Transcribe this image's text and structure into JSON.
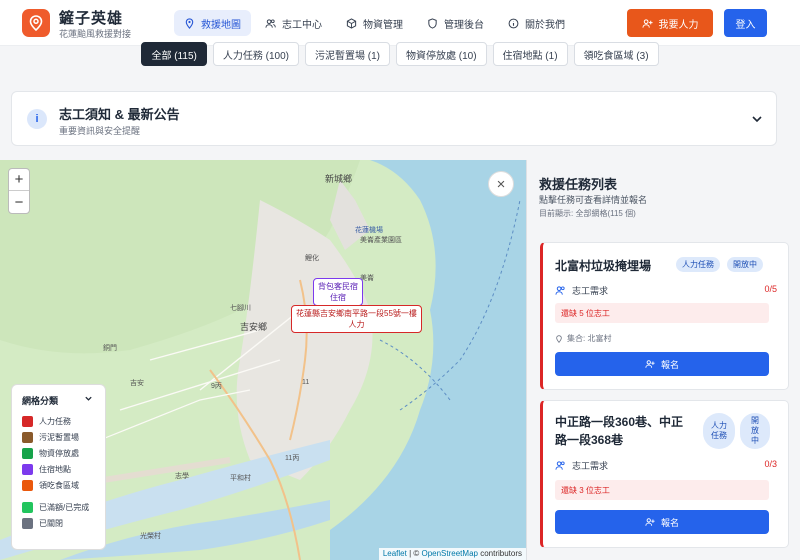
{
  "brand": {
    "title": "鏟子英雄",
    "subtitle": "花蓮颱風救援對接"
  },
  "nav": [
    {
      "label": "救援地圖",
      "icon": "map-pin-icon",
      "active": true
    },
    {
      "label": "志工中心",
      "icon": "users-icon",
      "active": false
    },
    {
      "label": "物資管理",
      "icon": "box-icon",
      "active": false
    },
    {
      "label": "管理後台",
      "icon": "shield-icon",
      "active": false
    },
    {
      "label": "關於我們",
      "icon": "info-icon",
      "active": false
    }
  ],
  "actions": {
    "need_label": "我要人力",
    "login_label": "登入"
  },
  "filters": [
    {
      "label": "全部 (115)",
      "active": true
    },
    {
      "label": "人力任務 (100)",
      "active": false
    },
    {
      "label": "污泥暫置場 (1)",
      "active": false
    },
    {
      "label": "物資停放處 (10)",
      "active": false
    },
    {
      "label": "住宿地點 (1)",
      "active": false
    },
    {
      "label": "領吃食區域 (3)",
      "active": false
    }
  ],
  "notice": {
    "title": "志工須知 & 最新公告",
    "subtitle": "重要資訊與安全提醒"
  },
  "map": {
    "zoom_in": "+",
    "zoom_out": "−",
    "close": "×",
    "labels": {
      "xinchengxiang": "新城鄉",
      "jian": "吉安鄉",
      "shoufeng": "壽豐鄉",
      "hualien_city": "花蓮市",
      "qijiao": "七腳川",
      "airport": "花蓮機場",
      "industrial": "美崙產業園區",
      "meilun": "美崙",
      "road9": "9丙",
      "road11": "11",
      "road11b": "11丙",
      "tongmen": "銅門",
      "jiren": "吉安",
      "zhixue": "志學",
      "pingtou": "平和村",
      "guangfu": "光榮村",
      "fengshan": "鳳林",
      "xunli": "順利"
    },
    "marker_backpack": {
      "title": "背包客民宿",
      "tag": "住宿"
    },
    "marker_task": {
      "title": "花蓮縣吉安鄉南平路一段55號一樓",
      "tag": "人力"
    },
    "attribution": {
      "leaflet": "Leaflet",
      "sep": " | © ",
      "osm": "OpenStreetMap",
      "tail": " contributors"
    }
  },
  "legend": {
    "title": "網格分類",
    "items": [
      {
        "label": "人力任務",
        "color": "#d62828"
      },
      {
        "label": "污泥暫置場",
        "color": "#8a5a2b"
      },
      {
        "label": "物資停放處",
        "color": "#16a34a"
      },
      {
        "label": "住宿地點",
        "color": "#7c3aed"
      },
      {
        "label": "領吃食區域",
        "color": "#ea580c"
      },
      {
        "label": "已滿額/已完成",
        "color": "#22c55e"
      },
      {
        "label": "已關閉",
        "color": "#6b7280"
      }
    ]
  },
  "panel": {
    "title": "救援任務列表",
    "subtitle": "點擊任務可查看詳情並報名",
    "count": "目前顯示: 全部網格(115 個)",
    "cards": [
      {
        "title": "北富村垃圾掩埋場",
        "tag_type": "人力任務",
        "tag_status": "開放中",
        "req_label": "志工需求",
        "req_value": "0/5",
        "shortage": "還缺 5 位志工",
        "location": "集合: 北富村",
        "signup": "報名"
      },
      {
        "title_line1": "中正路一段360巷、中正",
        "title_line2": "路一段368巷",
        "tag_type_a": "人力",
        "tag_type_b": "任務",
        "tag_status_a": "開",
        "tag_status_b": "放",
        "tag_status_c": "中",
        "req_label": "志工需求",
        "req_value": "0/3",
        "shortage": "還缺 3 位志工",
        "signup": "報名"
      }
    ]
  }
}
